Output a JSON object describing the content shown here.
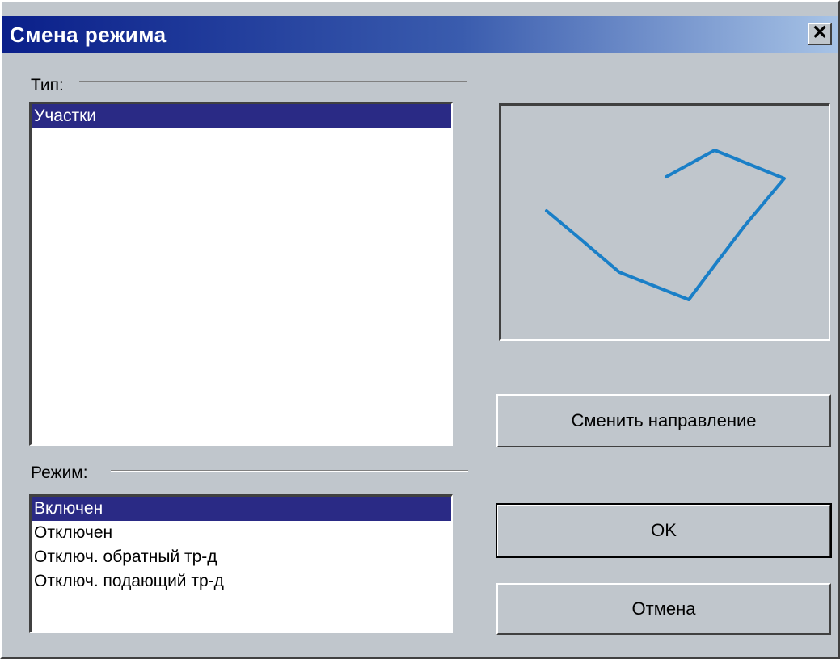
{
  "window": {
    "title": "Смена режима",
    "close_glyph": "✕"
  },
  "type_group": {
    "label": "Тип:",
    "items": [
      "Участки"
    ],
    "selected": "Участки"
  },
  "mode_group": {
    "label": "Режим:",
    "items": [
      "Включен",
      "Отключен",
      "Отключ. обратный тр-д",
      "Отключ. подающий тр-д"
    ],
    "selected": "Включен"
  },
  "preview": {
    "line_color": "#1a7fc7"
  },
  "buttons": {
    "change_direction": "Сменить направление",
    "ok": "OK",
    "cancel": "Отмена"
  }
}
